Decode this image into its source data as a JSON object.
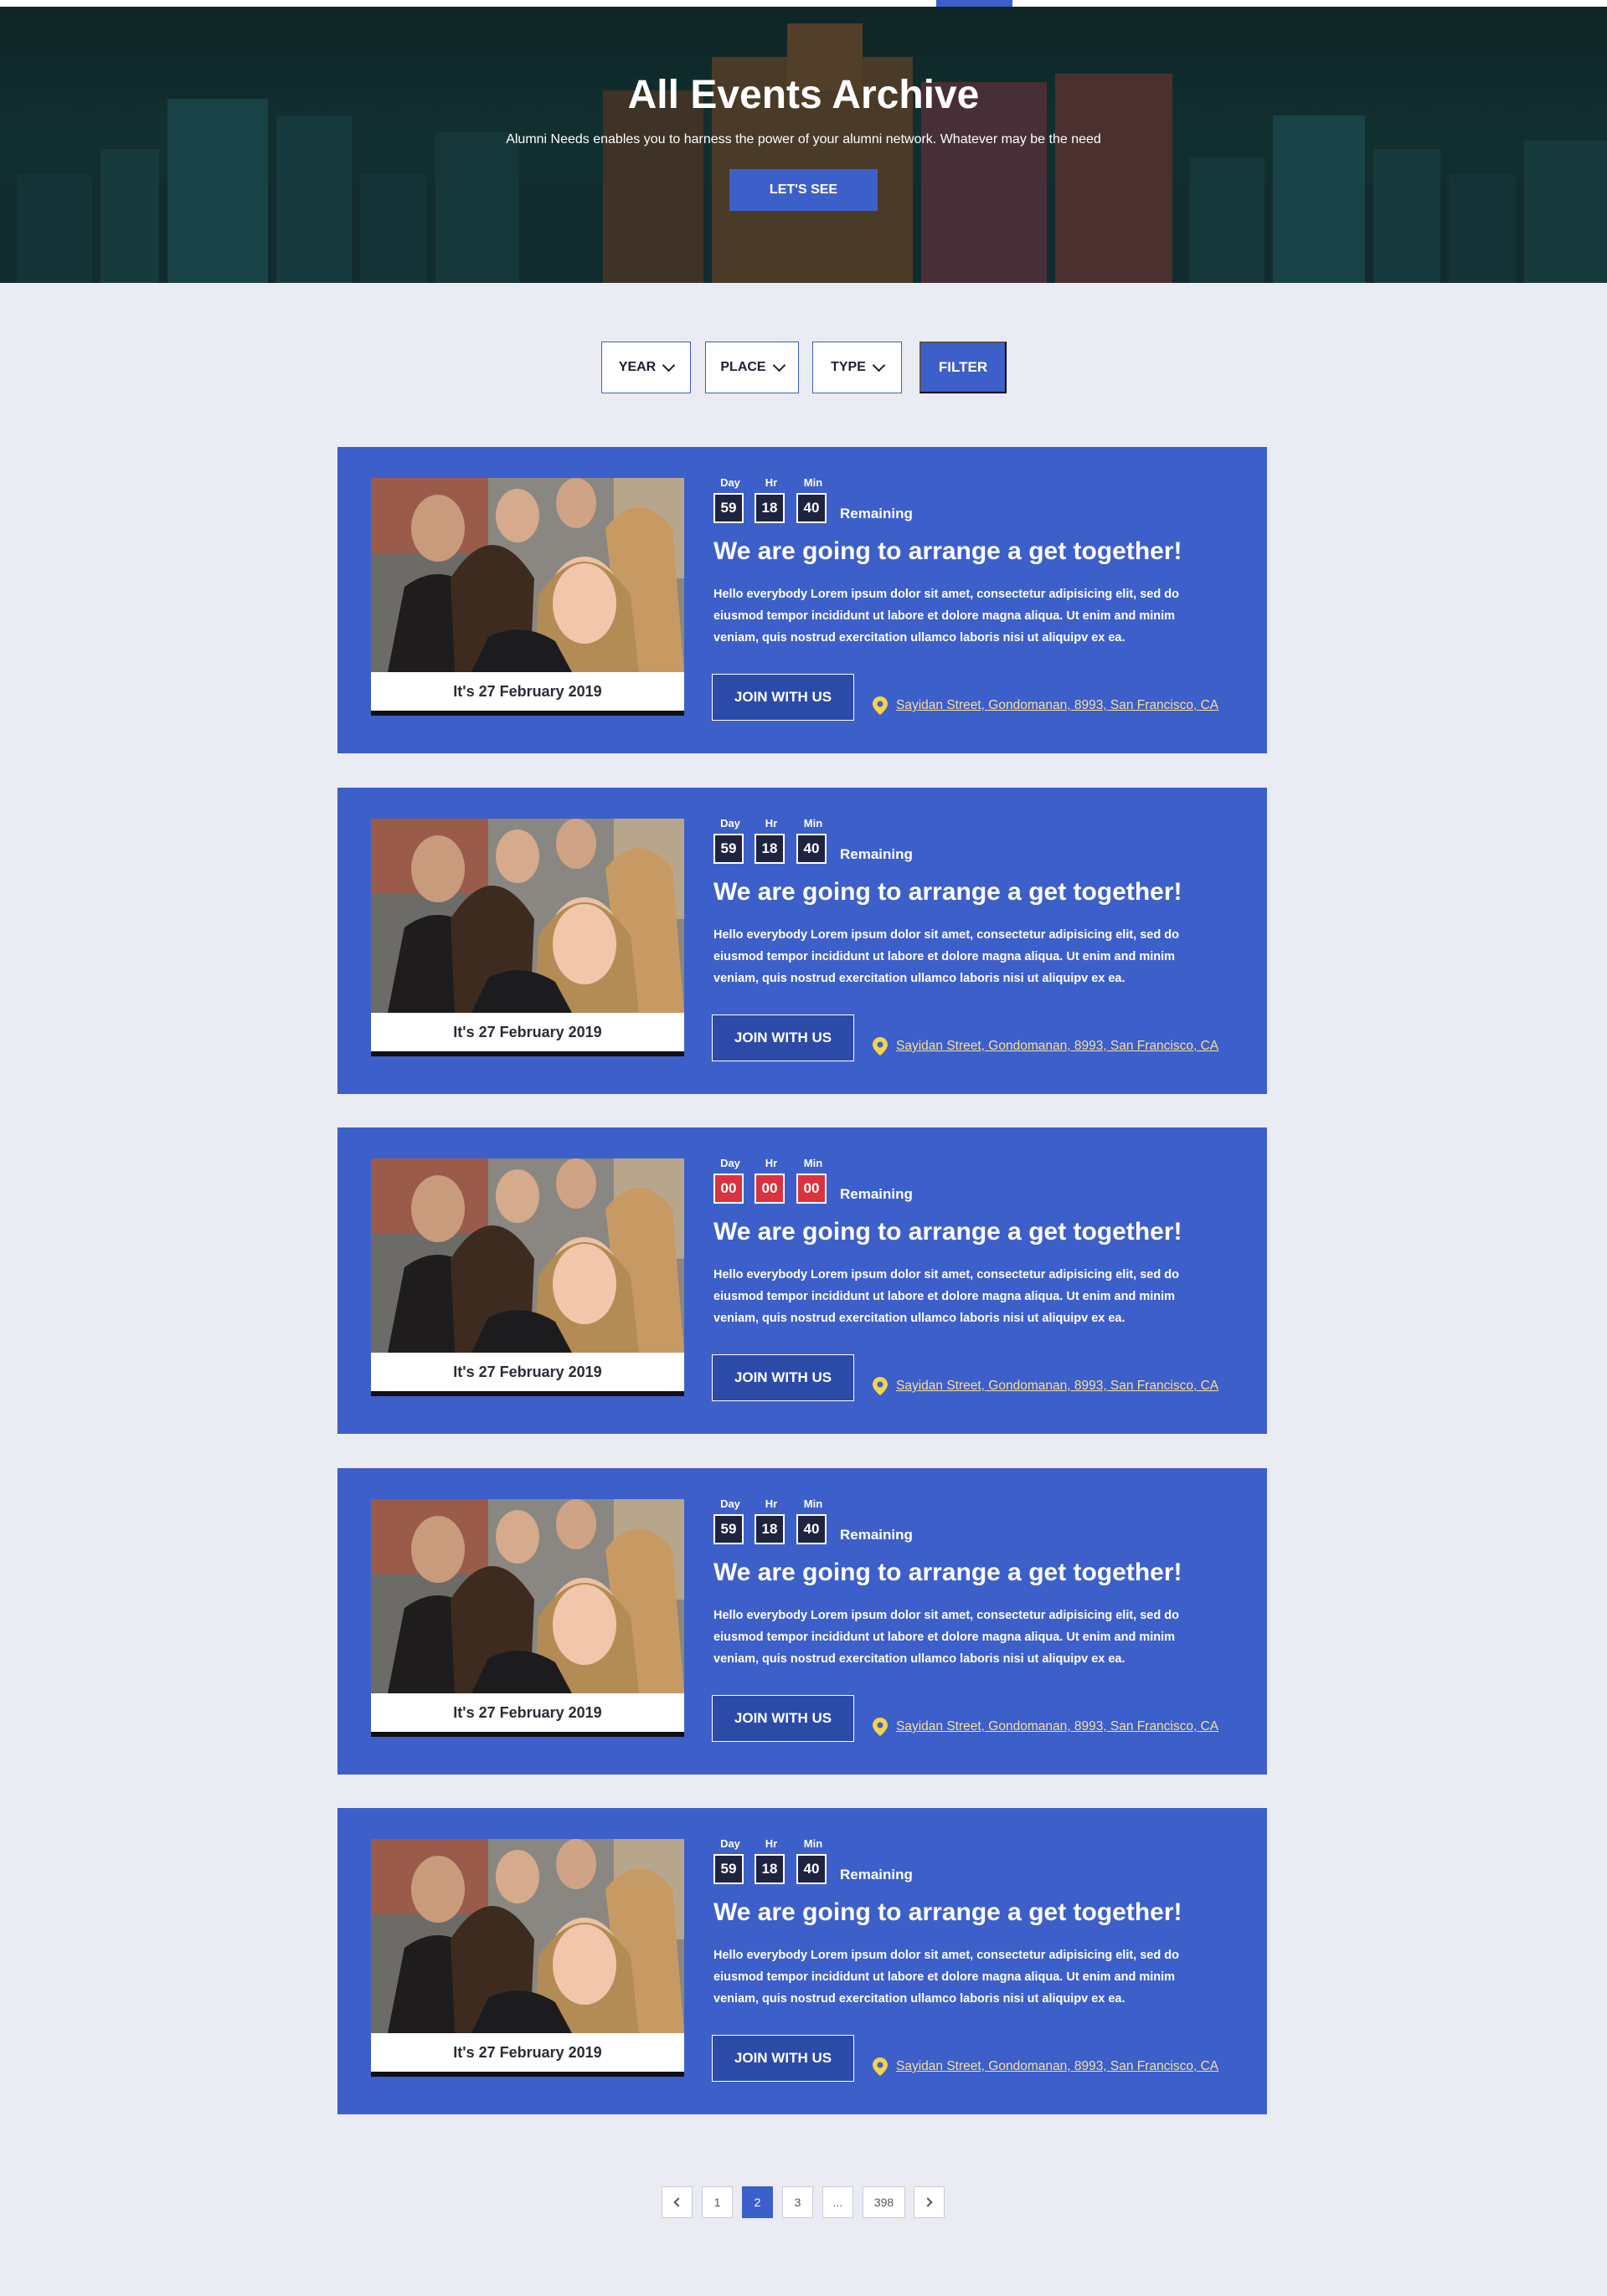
{
  "hero": {
    "title": "All Events Archive",
    "subtitle": "Alumni Needs enables you to harness the power of your alumni network. Whatever may be the need",
    "button_label": "LET'S SEE"
  },
  "filters": {
    "year_label": "YEAR",
    "place_label": "PLACE",
    "type_label": "TYPE",
    "filter_button": "FILTER"
  },
  "countdown_labels": {
    "day": "Day",
    "hr": "Hr",
    "min": "Min"
  },
  "events": [
    {
      "date": "It's 27 February 2019",
      "day": "59",
      "hr": "18",
      "min": "40",
      "remaining": "Remaining",
      "expired": false,
      "title": "We are going to arrange a get together!",
      "text": "Hello everybody Lorem ipsum dolor sit amet, consectetur adipisicing elit, sed do eiusmod tempor incididunt ut labore et dolore magna aliqua. Ut enim and minim veniam, quis nostrud exercitation ullamco laboris nisi ut aliquipv ex ea.",
      "button": "JOIN WITH US",
      "location": "Sayidan Street, Gondomanan, 8993, San Francisco, CA"
    },
    {
      "date": "It's 27 February 2019",
      "day": "59",
      "hr": "18",
      "min": "40",
      "remaining": "Remaining",
      "expired": false,
      "title": "We are going to arrange a get together!",
      "text": "Hello everybody Lorem ipsum dolor sit amet, consectetur adipisicing elit, sed do eiusmod tempor incididunt ut labore et dolore magna aliqua. Ut enim and minim veniam, quis nostrud exercitation ullamco laboris nisi ut aliquipv ex ea.",
      "button": "JOIN WITH US",
      "location": "Sayidan Street, Gondomanan, 8993, San Francisco, CA"
    },
    {
      "date": "It's 27 February 2019",
      "day": "00",
      "hr": "00",
      "min": "00",
      "remaining": "Remaining",
      "expired": true,
      "title": "We are going to arrange a get together!",
      "text": "Hello everybody Lorem ipsum dolor sit amet, consectetur adipisicing elit, sed do eiusmod tempor incididunt ut labore et dolore magna aliqua. Ut enim and minim veniam, quis nostrud exercitation ullamco laboris nisi ut aliquipv ex ea.",
      "button": "JOIN WITH US",
      "location": "Sayidan Street, Gondomanan, 8993, San Francisco, CA"
    },
    {
      "date": "It's 27 February 2019",
      "day": "59",
      "hr": "18",
      "min": "40",
      "remaining": "Remaining",
      "expired": false,
      "title": "We are going to arrange a get together!",
      "text": "Hello everybody Lorem ipsum dolor sit amet, consectetur adipisicing elit, sed do eiusmod tempor incididunt ut labore et dolore magna aliqua. Ut enim and minim veniam, quis nostrud exercitation ullamco laboris nisi ut aliquipv ex ea.",
      "button": "JOIN WITH US",
      "location": "Sayidan Street, Gondomanan, 8993, San Francisco, CA"
    },
    {
      "date": "It's 27 February 2019",
      "day": "59",
      "hr": "18",
      "min": "40",
      "remaining": "Remaining",
      "expired": false,
      "title": "We are going to arrange a get together!",
      "text": "Hello everybody Lorem ipsum dolor sit amet, consectetur adipisicing elit, sed do eiusmod tempor incididunt ut labore et dolore magna aliqua. Ut enim and minim veniam, quis nostrud exercitation ullamco laboris nisi ut aliquipv ex ea.",
      "button": "JOIN WITH US",
      "location": "Sayidan Street, Gondomanan, 8993, San Francisco, CA"
    }
  ],
  "pagination": {
    "pages": [
      "1",
      "2",
      "3",
      "...",
      "398"
    ],
    "active": "2",
    "prev_icon": "chevron-left-icon",
    "next_icon": "chevron-right-icon"
  },
  "colors": {
    "accent": "#3d5fc9",
    "page_bg": "#eaebf3",
    "expired": "#d8333f",
    "location_link": "#f7df9a"
  }
}
